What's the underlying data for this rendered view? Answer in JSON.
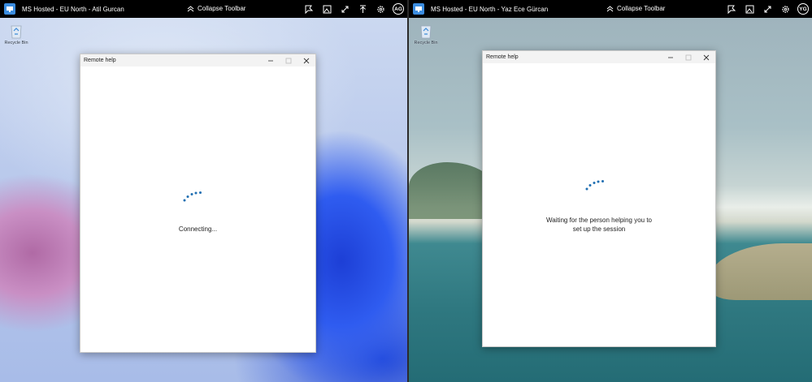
{
  "left": {
    "host": {
      "title": "MS Hosted - EU North - Atil Gurcan",
      "collapse_label": "Collapse Toolbar",
      "avatar_initials": "AG"
    },
    "desktop": {
      "recycle_bin_label": "Recycle Bin"
    },
    "window": {
      "title": "Remote help",
      "status_line1": "Connecting...",
      "status_line2": ""
    }
  },
  "right": {
    "host": {
      "title": "MS Hosted - EU North - Yaz Ece Gürcan",
      "collapse_label": "Collapse Toolbar",
      "avatar_initials": "YG"
    },
    "desktop": {
      "recycle_bin_label": "Recycle Bin"
    },
    "window": {
      "title": "Remote help",
      "status_line1": "Waiting for the person helping you to",
      "status_line2": "set up the session"
    }
  },
  "colors": {
    "accent": "#1f6fb2",
    "hostbar": "#000000",
    "host_logo": "#3b8de0"
  },
  "icons": {
    "host_toolbar": [
      "annotate-icon",
      "image-icon",
      "expand-icon",
      "upload-icon",
      "settings-icon"
    ],
    "window_controls": [
      "minimize-icon",
      "maximize-icon",
      "close-icon"
    ],
    "status": "loading-spinner-icon"
  }
}
